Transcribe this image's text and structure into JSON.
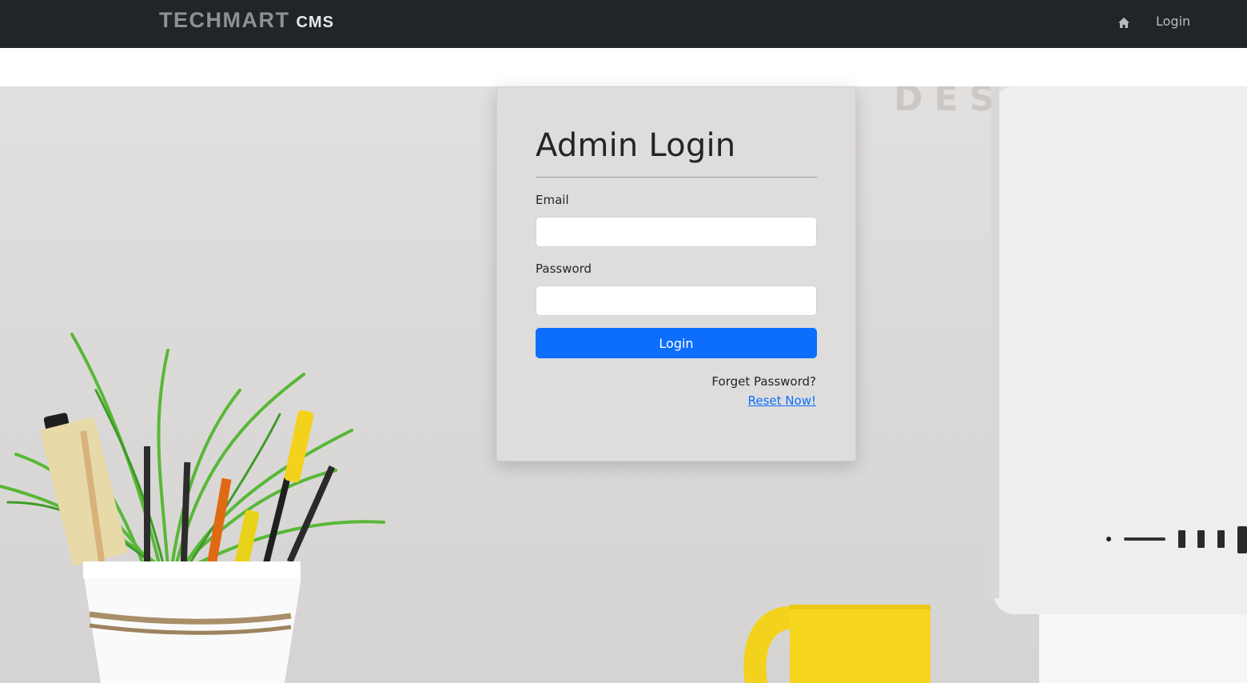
{
  "navbar": {
    "brand_main": "TECHMART",
    "brand_sub": "CMS",
    "home_icon": "home-icon",
    "login_label": "Login"
  },
  "login_form": {
    "title": "Admin Login",
    "email_label": "Email",
    "email_value": "",
    "password_label": "Password",
    "password_value": "",
    "submit_label": "Login",
    "forget_text": "Forget Password?",
    "reset_link": "Reset Now!"
  },
  "colors": {
    "navbar_bg": "#212529",
    "primary": "#0d6efd",
    "text_dark": "#212529"
  }
}
